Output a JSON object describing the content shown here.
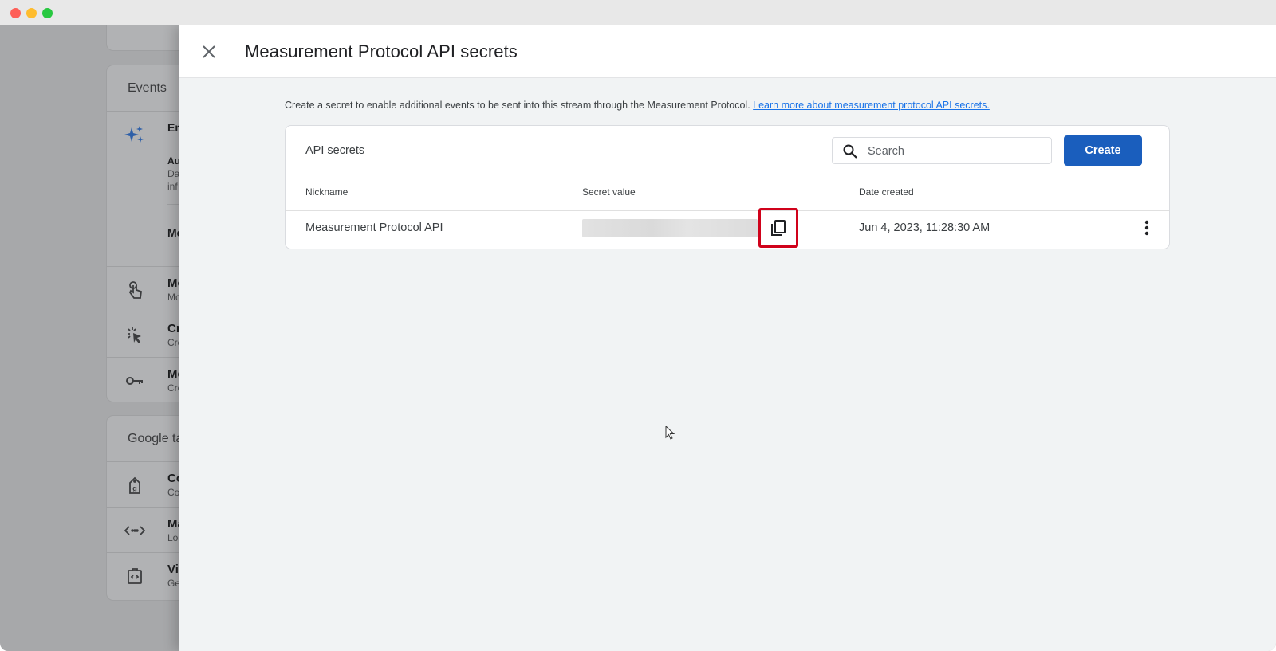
{
  "window": {
    "controls": [
      "close",
      "minimize",
      "maximize"
    ]
  },
  "background": {
    "cards": [
      {
        "title": "Events",
        "items": [
          {
            "icon": "sparkle-icon",
            "title": "En",
            "subtitle_lines": [
              "Au",
              "Da",
              "inf"
            ],
            "footer": "Me"
          },
          {
            "icon": "touch-icon",
            "title": "Mo",
            "subtitle": "Mo"
          },
          {
            "icon": "click-cursor-icon",
            "title": "Cr",
            "subtitle": "Cre"
          },
          {
            "icon": "key-icon",
            "title": "Me",
            "subtitle": "Cre"
          }
        ]
      },
      {
        "title": "Google ta",
        "items": [
          {
            "icon": "tag-icon",
            "title": "Co",
            "subtitle": "Co"
          },
          {
            "icon": "code-icon",
            "title": "Ma",
            "subtitle": "Lo"
          },
          {
            "icon": "code-clipboard-icon",
            "title": "Vi",
            "subtitle": "Ge"
          }
        ]
      }
    ]
  },
  "drawer": {
    "title": "Measurement Protocol API secrets",
    "close_icon": "close-icon",
    "description": "Create a secret to enable additional events to be sent into this stream through the Measurement Protocol.",
    "learn_more_link": "Learn more about measurement protocol API secrets.",
    "table": {
      "heading": "API secrets",
      "search": {
        "placeholder": "Search",
        "value": ""
      },
      "create_label": "Create",
      "columns": [
        "Nickname",
        "Secret value",
        "Date created"
      ],
      "rows": [
        {
          "nickname": "Measurement Protocol API",
          "secret_value": "(hidden)",
          "date_created": "Jun 4, 2023, 11:28:30 AM"
        }
      ]
    }
  },
  "colors": {
    "primary_button": "#1a5ebd",
    "link": "#1a73e8",
    "highlight_box": "#d0021b"
  }
}
